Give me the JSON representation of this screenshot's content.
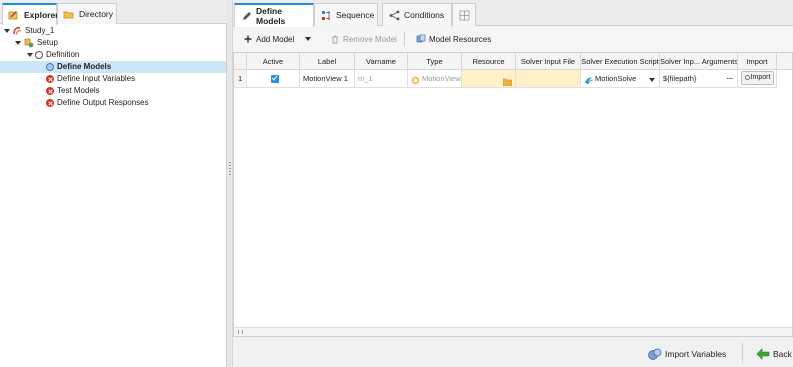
{
  "left_tabs": [
    {
      "label": "Explorer",
      "icon": "explorer-icon",
      "active": true
    },
    {
      "label": "Directory",
      "icon": "folder-icon",
      "active": false
    }
  ],
  "tree": {
    "study": "Study_1",
    "setup": "Setup",
    "definition": "Definition",
    "items": [
      {
        "label": "Define Models",
        "status": "current"
      },
      {
        "label": "Define Input Variables",
        "status": "error"
      },
      {
        "label": "Test Models",
        "status": "error"
      },
      {
        "label": "Define Output Responses",
        "status": "error"
      }
    ]
  },
  "right_tabs": [
    {
      "label": "Define Models",
      "icon": "pencil-icon",
      "active": true
    },
    {
      "label": "Sequence",
      "icon": "sequence-icon",
      "active": false
    },
    {
      "label": "Conditions",
      "icon": "conditions-icon",
      "active": false
    },
    {
      "label": "",
      "icon": "grid-icon",
      "active": false
    }
  ],
  "toolbar": {
    "add_model": "Add Model",
    "remove_model": "Remove Model",
    "model_resources": "Model Resources"
  },
  "table": {
    "columns": [
      "",
      "Active",
      "Label",
      "Varname",
      "Type",
      "Resource",
      "Solver Input File",
      "Solver Execution Script",
      "Solver Inp... Arguments",
      "Import"
    ],
    "rows": [
      {
        "num": "1",
        "active": true,
        "label": "MotionView 1",
        "varname": "m_1",
        "type": "MotionView",
        "resource": "",
        "solver_input_file": "",
        "solver_script": "MotionSolve",
        "arguments": "${filepath}",
        "arguments_more": "...",
        "import": "Import"
      }
    ]
  },
  "bottom": {
    "import_variables": "Import Variables",
    "back": "Back"
  },
  "colors": {
    "accent": "#1a8fd6",
    "selection": "#cce6f7",
    "error": "#d9302a",
    "highlight_cell": "#fff0c8"
  }
}
